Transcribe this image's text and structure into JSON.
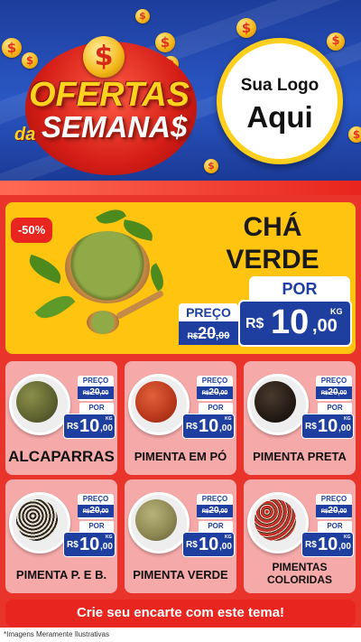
{
  "header": {
    "title_line1": "OFERTAS",
    "title_da": "da",
    "title_line2": "SEMANA$",
    "coin_symbol": "$",
    "logo_line1": "Sua Logo",
    "logo_line2": "Aqui"
  },
  "hero": {
    "discount_badge": "-50%",
    "product_name": "CHÁ VERDE",
    "price_label": "PREÇO",
    "old_price_currency": "R$",
    "old_price_int": "20",
    "old_price_cents": ",00",
    "por_label": "POR",
    "currency": "R$",
    "new_price_int": "10",
    "new_price_cents": ",00",
    "unit": "KG"
  },
  "products": [
    {
      "name": "ALCAPARRAS",
      "price_label": "PREÇO",
      "old_currency": "R$",
      "old_int": "20",
      "old_cents": ",00",
      "por_label": "POR",
      "currency": "R$",
      "price_int": "10",
      "price_cents": ",00",
      "unit": "KG"
    },
    {
      "name": "PIMENTA EM PÓ",
      "price_label": "PREÇO",
      "old_currency": "R$",
      "old_int": "20",
      "old_cents": ",00",
      "por_label": "POR",
      "currency": "R$",
      "price_int": "10",
      "price_cents": ",00",
      "unit": "KG"
    },
    {
      "name": "PIMENTA PRETA",
      "price_label": "PREÇO",
      "old_currency": "R$",
      "old_int": "20",
      "old_cents": ",00",
      "por_label": "POR",
      "currency": "R$",
      "price_int": "10",
      "price_cents": ",00",
      "unit": "KG"
    },
    {
      "name": "PIMENTA P. E B.",
      "price_label": "PREÇO",
      "old_currency": "R$",
      "old_int": "20",
      "old_cents": ",00",
      "por_label": "POR",
      "currency": "R$",
      "price_int": "10",
      "price_cents": ",00",
      "unit": "KG"
    },
    {
      "name": "PIMENTA VERDE",
      "price_label": "PREÇO",
      "old_currency": "R$",
      "old_int": "20",
      "old_cents": ",00",
      "por_label": "POR",
      "currency": "R$",
      "price_int": "10",
      "price_cents": ",00",
      "unit": "KG"
    },
    {
      "name": "PIMENTAS COLORIDAS",
      "price_label": "PREÇO",
      "old_currency": "R$",
      "old_int": "20",
      "old_cents": ",00",
      "por_label": "POR",
      "currency": "R$",
      "price_int": "10",
      "price_cents": ",00",
      "unit": "KG"
    }
  ],
  "cta": "Crie seu encarte com este tema!",
  "footer_note": "*Imagens Meramente Ilustrativas",
  "colors": {
    "header_blue": "#1d3d9c",
    "accent_red": "#e8251e",
    "accent_yellow": "#ffc410",
    "price_blue": "#1e3fa0",
    "card_pink": "#f6a9a9"
  }
}
